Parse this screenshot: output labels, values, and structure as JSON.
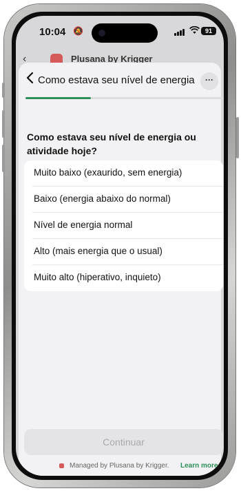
{
  "status_bar": {
    "time": "10:04",
    "battery": "91"
  },
  "background_app": {
    "title": "Plusana by Krigger"
  },
  "sheet": {
    "title": "Como estava seu nível de energia ...",
    "more_label": "···",
    "progress": 0.33
  },
  "question": "Como estava seu nível de energia ou atividade hoje?",
  "options": [
    {
      "label": "Muito baixo (exaurido, sem energia)"
    },
    {
      "label": "Baixo (energia abaixo do normal)"
    },
    {
      "label": "Nível de energia normal"
    },
    {
      "label": "Alto (mais energia que o usual)"
    },
    {
      "label": "Muito alto (hiperativo, inquieto)"
    }
  ],
  "continue_label": "Continuar",
  "footer": {
    "managed_text": "Managed by Plusana by Krigger.",
    "learn_more": "Learn more"
  },
  "colors": {
    "accent": "#2c8f58",
    "brand": "#d55a5a"
  }
}
